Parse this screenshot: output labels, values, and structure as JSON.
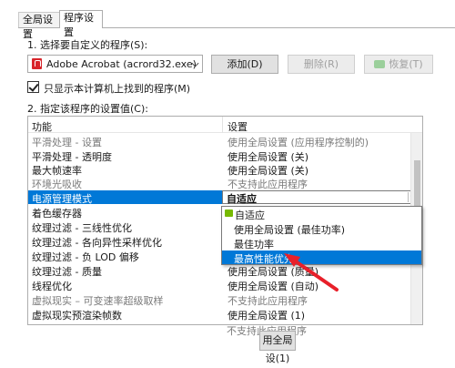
{
  "tabs": [
    {
      "label": "全局设置"
    },
    {
      "label": "程序设置"
    }
  ],
  "section1": {
    "label": "1. 选择要自定义的程序(S):"
  },
  "program_select": {
    "value": "Adobe Acrobat (acrord32.exe)"
  },
  "buttons": {
    "add": "添加(D)",
    "remove": "删除(R)",
    "restore": "恢复(T)"
  },
  "checkbox": {
    "label": "只显示本计算机上找到的程序(M)",
    "checked": true
  },
  "section2": {
    "label": "2. 指定该程序的设置值(C):"
  },
  "grid": {
    "col_feature": "功能",
    "col_setting": "设置",
    "rows": [
      {
        "feature": "平滑处理 - 设置",
        "setting": "使用全局设置 (应用程序控制的)"
      },
      {
        "feature": "平滑处理 - 透明度",
        "setting": "使用全局设置 (关)"
      },
      {
        "feature": "最大帧速率",
        "setting": "使用全局设置 (关)"
      },
      {
        "feature": "环境光吸收",
        "setting": "不支持此应用程序"
      },
      {
        "feature": "电源管理模式",
        "setting": "自适应"
      },
      {
        "feature": "着色缓存器",
        "setting": ""
      },
      {
        "feature": "纹理过滤 - 三线性优化",
        "setting": ""
      },
      {
        "feature": "纹理过滤 - 各向异性采样优化",
        "setting": ""
      },
      {
        "feature": "纹理过滤 - 负 LOD 偏移",
        "setting": ""
      },
      {
        "feature": "纹理过滤 - 质量",
        "setting": "使用全局设置 (质量)"
      },
      {
        "feature": "线程优化",
        "setting": "使用全局设置 (自动)"
      },
      {
        "feature": "虚拟现实 – 可变速率超级取样",
        "setting": "不支持此应用程序"
      },
      {
        "feature": "虚拟现实预渲染帧数",
        "setting": "使用全局设置 (1)"
      }
    ],
    "extra_below": "不支持此应用程序"
  },
  "dropdown": {
    "options": [
      {
        "label": "自适应"
      },
      {
        "label": "使用全局设置 (最佳功率)"
      },
      {
        "label": "最佳功率"
      },
      {
        "label": "最高性能优先"
      }
    ],
    "highlighted": "最高性能优先"
  },
  "bottom": {
    "apply_partial": "用全局设(1)"
  },
  "colors": {
    "selection": "#0078d7",
    "arrow": "#e8202a"
  }
}
